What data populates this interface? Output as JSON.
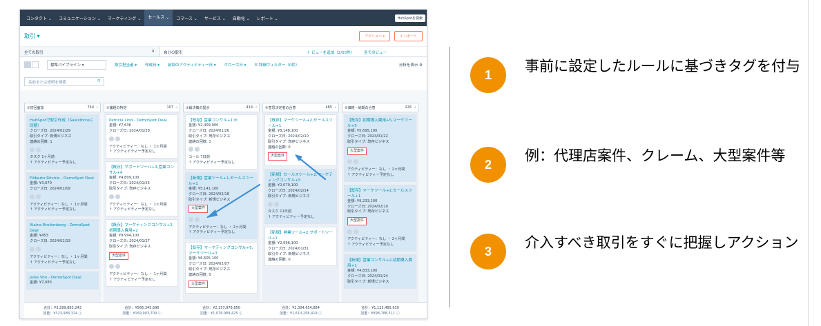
{
  "nav": {
    "items": [
      "コンタクト ⌄",
      "コミュニケーション ⌄",
      "マーケティング ⌄",
      "セールス ⌄",
      "コマース ⌄",
      "サービス ⌄",
      "自動化 ⌄",
      "レポート ⌄"
    ],
    "search": "HubSpotを検索"
  },
  "header": {
    "title": "取引 ▾",
    "action1": "アクション ▾",
    "action2": "インポート"
  },
  "tabs": {
    "tab1": "全ての取引",
    "tab1_close": "✕",
    "tab2": "自分の取引",
    "add_view": "＋ ビューを追加（2/50件）",
    "all_views": "全てのビュー"
  },
  "filters": {
    "pipeline": "標準パイプライン ▾",
    "owner": "取引担当者 ▾",
    "created": "作成日 ▾",
    "activity": "前回のアクティビティー日 ▾",
    "close": "クローズ日 ▾",
    "advanced": "☰ 詳細フィルター（0件）",
    "analyze": "分析を表示 ⚙"
  },
  "search": {
    "placeholder": "名前または説明を検索",
    "icon": "magnifier-icon"
  },
  "columns": [
    {
      "name": "①初回面談",
      "count": "744",
      "cards": [
        {
          "title": "HubSpotで取引作成（Salesforceに同期）",
          "lines": [
            "クローズ日: 2024/02/29",
            "取引タイプ: 新規ビジネス",
            "連絡の回数: 1"
          ],
          "tag": "",
          "footer": [
            "タスク 1ヶ月前",
            "↑ アクティビティー予定なし"
          ],
          "hl": true
        },
        {
          "title": "Filiberto Ritchie - DemoSpot Deal",
          "lines": [
            "金額: ¥3,070",
            "クローズ日: 2024/02/09"
          ],
          "tag": "",
          "footer": [
            "アクティビティー：なし ・ 1ヶ月間",
            "↑ アクティビティー予定なし"
          ],
          "hl": true
        },
        {
          "title": "Alaina Breitenberg - DemoSpot Deal",
          "lines": [
            "金額: ¥453",
            "クローズ日: 2024/02/19"
          ],
          "tag": "",
          "footer": [
            "アクティビティー：なし ・ 1ヶ月間",
            "↑ アクティビティー予定なし"
          ],
          "hl": true
        },
        {
          "title": "Jules Von - DemoSpot Deal",
          "lines": [
            "金額: ¥7,083"
          ],
          "tag": "",
          "footer": [],
          "hl": true
        }
      ]
    },
    {
      "name": "②課題の特定",
      "count": "107",
      "cards": [
        {
          "title": "Patricia Lind - DemoSpot Deal",
          "lines": [
            "金額: ¥7,636",
            "クローズ日: 2024/01/28"
          ],
          "tag": "",
          "footer": [
            "アクティビティー：なし ・ 1ヶ月間",
            "↑ アクティビティー予定なし"
          ],
          "hl": false
        },
        {
          "title": "【既存】サポートツール+3,営業コンサル+4",
          "lines": [
            "金額: ¥4,809,100",
            "クローズ日: 2024/01/25",
            "取引タイプ: 既存ビジネス"
          ],
          "tag": "",
          "footer": [
            "アクティビティー：なし ・ 1ヶ月間",
            "↑ アクティビティー予定なし"
          ],
          "hl": false
        },
        {
          "title": "【既存】マーケティングコンサル+2,初期導入費用+2",
          "lines": [
            "金額: ¥9,994,100",
            "クローズ日: 2024/01/27",
            "取引タイプ: 既存ビジネス"
          ],
          "tag": "大型案件",
          "footer": [
            "アクティビティー：なし ・ 1ヶ月間",
            "↑ アクティビティー予定なし"
          ],
          "hl": false
        }
      ]
    },
    {
      "name": "③解決策の提示",
      "count": "414",
      "cards": [
        {
          "title": "【既存】営業コンサル+1 ✉",
          "lines": [
            "金額: ¥2,409,000",
            "クローズ日: 2024/01/26",
            "取引タイプ: 既存ビジネス",
            "連絡の回数: 1"
          ],
          "tag": "",
          "footer": [
            "コール 7日前",
            "↑ アクティビティー予定なし"
          ],
          "hl": false
        },
        {
          "title": "【新規】営業ツール+1,セールスツール+1",
          "lines": [
            "金額: ¥5,141,100",
            "クローズ日: 2024/02/18",
            "取引タイプ: 新規ビジネス"
          ],
          "tag": "大型案件",
          "footer": [
            "アクティビティー：なし ・ 2ヶ月間",
            "↑ アクティビティー予定なし"
          ],
          "hl": true
        },
        {
          "title": "【既存】マーケティングコンサル+5,マーケツール+3",
          "lines": [
            "金額: ¥6,605,100",
            "クローズ日: 2024/02/07",
            "取引タイプ: 既存ビジネス",
            "連絡の回数: 0"
          ],
          "tag": "大型案件",
          "footer": [],
          "hl": false
        }
      ]
    },
    {
      "name": "④意思決定者の合意",
      "count": "485",
      "cards": [
        {
          "title": "【既存】マーケツール+2,セールスツール+1",
          "lines": [
            "金額: ¥8,148,100",
            "クローズ日: 2024/02/10",
            "取引タイプ: 既存ビジネス",
            "連絡の回数: 0"
          ],
          "tag": "大型案件",
          "footer": [],
          "hl": false
        },
        {
          "title": "【新規】セールスツール+2,マーケティングコンサル+5",
          "lines": [
            "金額: ¥2,079,100",
            "クローズ日: 2024/02/14",
            "取引タイプ: 新規ビジネス"
          ],
          "tag": "",
          "footer": [
            "タスク 11日前",
            "↑ アクティビティー予定なし"
          ],
          "hl": true
        },
        {
          "title": "【新規】営業ツール+2,サポートツール+1",
          "lines": [
            "金額: ¥2,996,100",
            "クローズ日: 2024/01/31",
            "取引タイプ: 新規ビジネス",
            "連絡の回数: 0"
          ],
          "tag": "",
          "footer": [],
          "hl": false
        }
      ]
    },
    {
      "name": "⑤価格・納期の合意",
      "count": "226",
      "cards": [
        {
          "title": "【既存】初期導入費用+5,マーケツール+5",
          "lines": [
            "金額: ¥5,695,100",
            "クローズ日: 2024/01/22",
            "取引タイプ: 既存ビジネス"
          ],
          "tag": "大型案件",
          "footer": [
            "アクティビティー：なし ・ 2ヶ月間",
            "↑ アクティビティー予定なし"
          ],
          "hl": true
        },
        {
          "title": "【既存】マーケツール+2,セールスツール+1",
          "lines": [
            "金額: ¥9,233,100",
            "クローズ日: 2024/02/10",
            "取引タイプ: 既存ビジネス"
          ],
          "tag": "大型案件",
          "footer": [
            "アクティビティー：なし ・ 2ヶ月間",
            "↑ アクティビティー予定なし"
          ],
          "hl": true
        },
        {
          "title": "【新規】営業コンサル+2,初期導入費用+1",
          "lines": [
            "金額: ¥4,833,100",
            "クローズ日: 2024/01/24",
            "取引タイプ: 新規ビジネス"
          ],
          "tag": "",
          "footer": [],
          "hl": true
        }
      ]
    }
  ],
  "totals": [
    {
      "sum": "合計：¥3,289,883,243",
      "weighted": "加重：¥323,988,324 ⓘ"
    },
    {
      "sum": "合計：¥566,345,696",
      "weighted": "加重：¥169,903,709 ⓘ"
    },
    {
      "sum": "合計：¥2,157,978,850",
      "weighted": "加重：¥1,078,989,425 ⓘ"
    },
    {
      "sum": "合計：¥2,304,654,884",
      "weighted": "加重：¥1,613,258,419 ⓘ"
    },
    {
      "sum": "合計：¥1,123,485,639",
      "weighted": "加重：¥898,788,511 ⓘ"
    }
  ],
  "points": [
    {
      "num": "1",
      "text": "事前に設定したルールに基づきタグを付与"
    },
    {
      "num": "2",
      "text": "例：代理店案件、クレーム、大型案件等"
    },
    {
      "num": "3",
      "text": "介入すべき取引をすぐに把握しアクション"
    }
  ],
  "colors": {
    "accent": "#f29100",
    "link": "#0091ae",
    "nav": "#2d3e50",
    "tag_border": "#f2545b",
    "arrow": "#3d8fd6"
  }
}
